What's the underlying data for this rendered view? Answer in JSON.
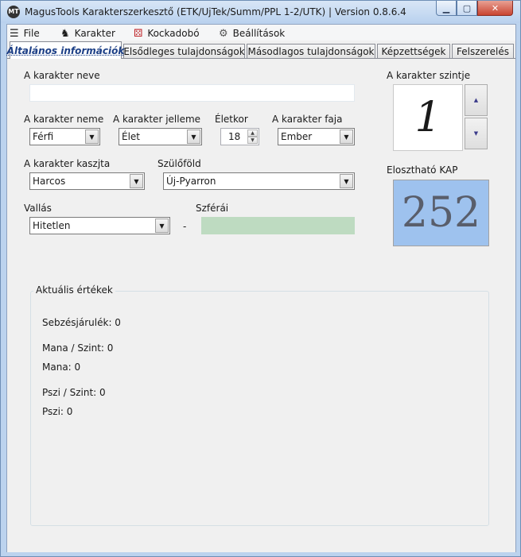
{
  "window": {
    "app_icon_text": "MT",
    "title": "MagusTools Karakterszerkesztő (ETK/UjTek/Summ/PPL 1-2/UTK) | Version 0.8.6.4",
    "minimize_icon": "minimize-icon",
    "maximize_icon": "maximize-icon",
    "close_icon": "close-icon"
  },
  "menu": {
    "file": "File",
    "karakter": "Karakter",
    "kockadobo": "Kockadobó",
    "beallitasok": "Beállítások"
  },
  "tabs": [
    {
      "label": "Általános információk",
      "active": true
    },
    {
      "label": "Elsődleges tulajdonságok",
      "active": false
    },
    {
      "label": "Másodlagos tulajdonságok",
      "active": false
    },
    {
      "label": "Képzettségek",
      "active": false
    },
    {
      "label": "Felszerelés",
      "active": false
    }
  ],
  "form": {
    "name_label": "A karakter neve",
    "name_value": "",
    "gender_label": "A karakter neme",
    "gender_value": "Férfi",
    "alignment_label": "A karakter jelleme",
    "alignment_value": "Élet",
    "age_label": "Életkor",
    "age_value": "18",
    "race_label": "A karakter faja",
    "race_value": "Ember",
    "class_label": "A karakter kaszjta",
    "class_value": "Harcos",
    "homeland_label": "Szülőföld",
    "homeland_value": "Új-Pyarron",
    "religion_label": "Vallás",
    "religion_value": "Hitetlen",
    "separator": "-",
    "spheres_label": "Szférái",
    "spheres_value": ""
  },
  "level": {
    "label": "A karakter szintje",
    "value": "1"
  },
  "kap": {
    "label": "Elosztható KAP",
    "value": "252"
  },
  "current": {
    "title": "Aktuális értékek",
    "items": [
      "Sebzésjárulék: 0",
      "Mana / Szint: 0",
      "Mana: 0",
      "Pszi / Szint: 0",
      "Pszi: 0"
    ]
  },
  "colors": {
    "kap_background": "#9ec2ee",
    "spheres_background": "#bedbc1",
    "active_tab_text": "#1c3f86"
  }
}
